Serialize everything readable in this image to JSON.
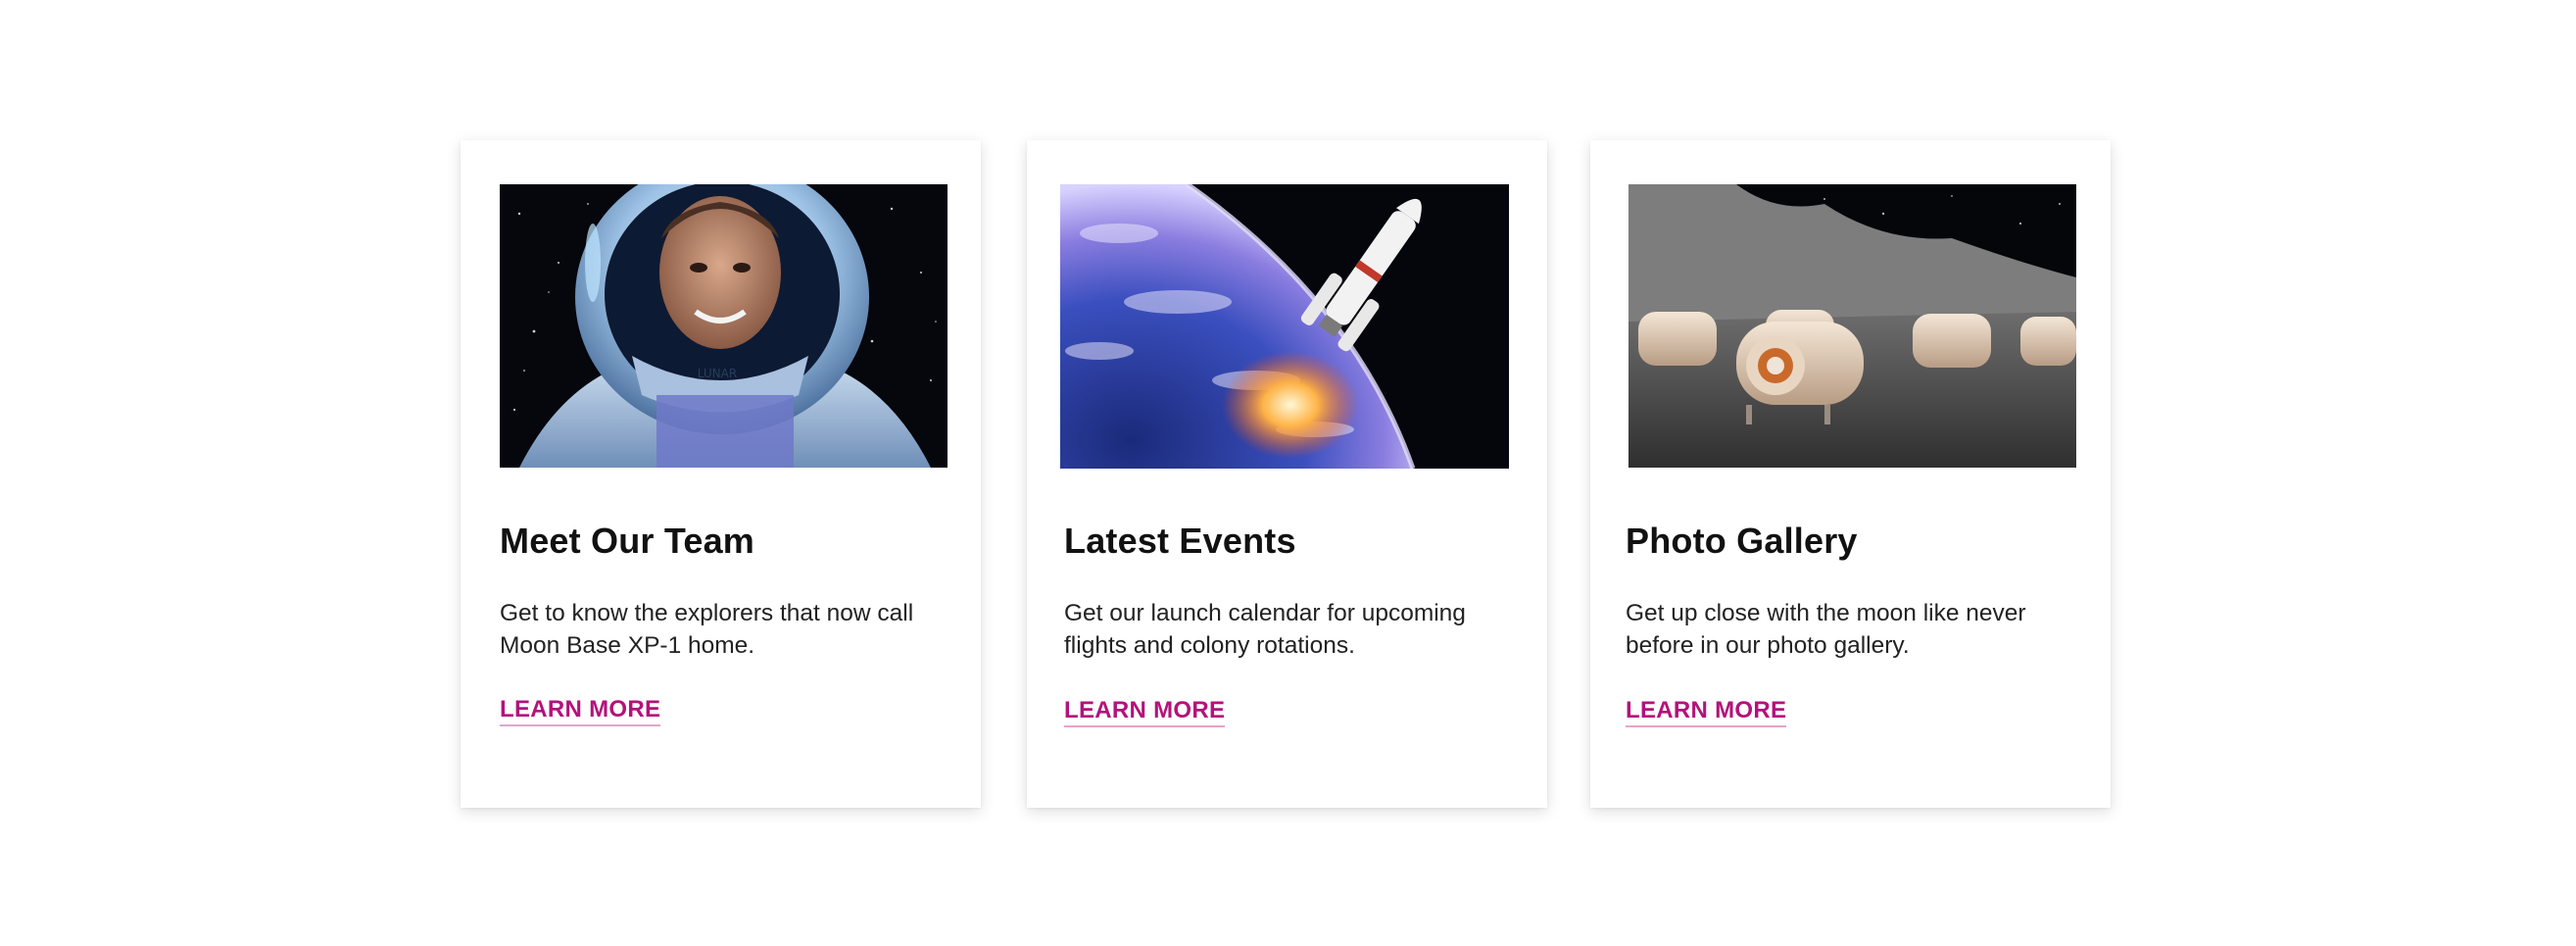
{
  "cards": [
    {
      "image_alt": "astronaut",
      "title": "Meet Our Team",
      "description": "Get to know the explorers that now call Moon Base XP-1 home.",
      "link_label": "LEARN MORE"
    },
    {
      "image_alt": "rocket launch",
      "title": "Latest Events",
      "description": "Get our launch calendar for upcoming flights and colony rotations.",
      "link_label": "LEARN MORE"
    },
    {
      "image_alt": "moon base modules",
      "title": "Photo Gallery",
      "description": "Get up close with the moon like never before in our photo gallery.",
      "link_label": "LEARN MORE"
    }
  ],
  "helmet_text": "LUNAR",
  "colors": {
    "link": "#b3127c",
    "link_underline": "#e6a3cc",
    "title": "#111111"
  }
}
